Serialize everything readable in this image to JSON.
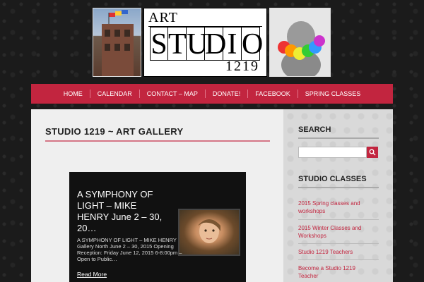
{
  "banner": {
    "logo_art": "ART",
    "logo_letters": [
      "S",
      "T",
      "U",
      "D",
      "I",
      "O"
    ],
    "logo_number": "1219"
  },
  "nav": {
    "items": [
      {
        "label": "HOME"
      },
      {
        "label": "CALENDAR"
      },
      {
        "label": "CONTACT – MAP"
      },
      {
        "label": "DONATE!"
      },
      {
        "label": "FACEBOOK"
      },
      {
        "label": "SPRING CLASSES"
      }
    ]
  },
  "main": {
    "page_title": "STUDIO 1219 ~ ART GALLERY",
    "post": {
      "title": "A SYMPHONY OF LIGHT – MIKE HENRY June 2 – 30, 20…",
      "excerpt": "A SYMPHONY OF LIGHT – MIKE HENRY Gallery North June 2 – 30, 2015 Opening Reception: Friday June 12, 2015 6-8:00pm – Open to Public…",
      "read_more": "Read More"
    }
  },
  "sidebar": {
    "search_heading": "SEARCH",
    "search_placeholder": "",
    "classes_heading": "STUDIO CLASSES",
    "links": [
      {
        "label": "2015 Spring classes and workshops"
      },
      {
        "label": "2015 Winter Classes and Workshops"
      },
      {
        "label": "Studio 1219 Teachers"
      },
      {
        "label": "Become a Studio 1219 Teacher"
      }
    ]
  },
  "colors": {
    "accent": "#c2253f",
    "background": "#1b1b1b"
  }
}
